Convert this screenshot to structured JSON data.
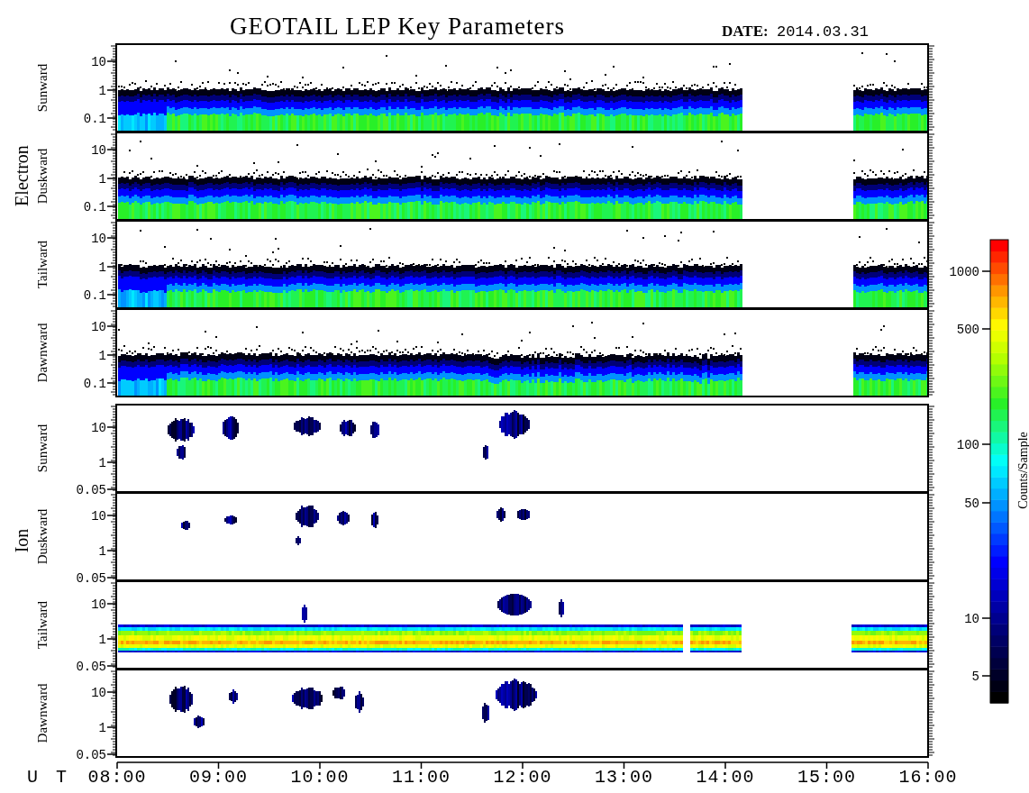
{
  "title": "GEOTAIL LEP Key Parameters",
  "date": {
    "label": "DATE:",
    "value": "2014.03.31"
  },
  "groups": [
    {
      "label": "Electron",
      "panels": [
        {
          "label": "Sunward",
          "kind": "electron",
          "yticks": [
            "10",
            "1",
            "0.1"
          ]
        },
        {
          "label": "Duskward",
          "kind": "electron",
          "yticks": [
            "10",
            "1",
            "0.1"
          ]
        },
        {
          "label": "Tailward",
          "kind": "electron",
          "yticks": [
            "10",
            "1",
            "0.1"
          ]
        },
        {
          "label": "Dawnward",
          "kind": "electron",
          "yticks": [
            "10",
            "1",
            "0.1"
          ]
        }
      ]
    },
    {
      "label": "Ion",
      "panels": [
        {
          "label": "Sunward",
          "kind": "ion-patches",
          "yticks": [
            "10",
            "1",
            "0.05"
          ]
        },
        {
          "label": "Duskward",
          "kind": "ion-patches",
          "yticks": [
            "10",
            "1",
            "0.05"
          ]
        },
        {
          "label": "Tailward",
          "kind": "ion-band",
          "yticks": [
            "10",
            "1",
            "0.05"
          ]
        },
        {
          "label": "Dawnward",
          "kind": "ion-patches",
          "yticks": [
            "10",
            "1",
            "0.05"
          ]
        }
      ]
    }
  ],
  "x_axis": {
    "label": "U T",
    "ticks": [
      "08:00",
      "09:00",
      "10:00",
      "11:00",
      "12:00",
      "13:00",
      "14:00",
      "15:00",
      "16:00"
    ]
  },
  "colorbar": {
    "label": "Counts/Sample",
    "ticks": [
      "1000",
      "500",
      "100",
      "50",
      "10",
      "5"
    ]
  }
}
